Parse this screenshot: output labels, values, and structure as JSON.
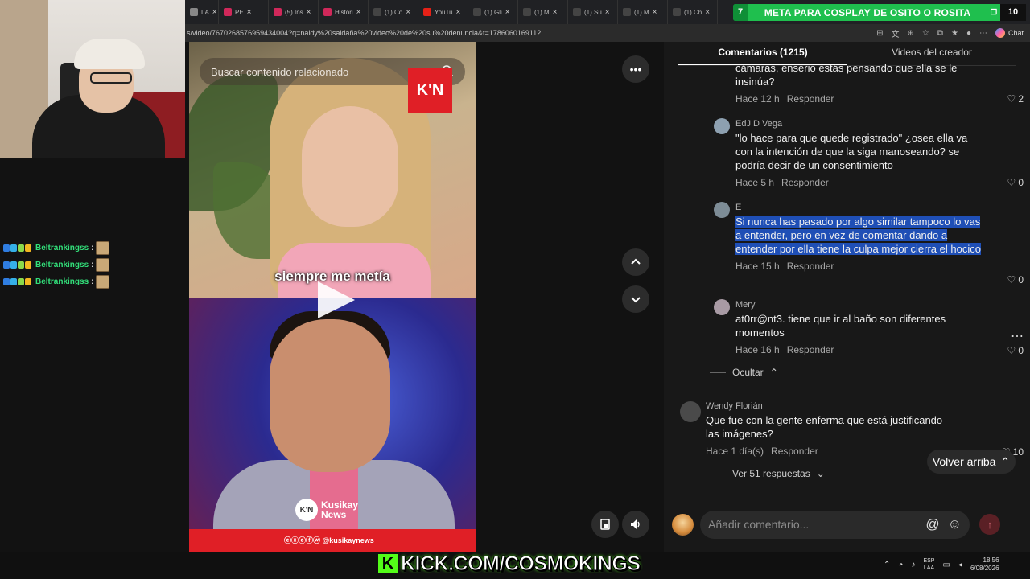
{
  "tabs": [
    {
      "label": "LA",
      "color": "#888888"
    },
    {
      "label": "PE",
      "color": "#d0285a"
    },
    {
      "label": "(5) Ins",
      "color": "#d0285a"
    },
    {
      "label": "Histori",
      "color": "#d0285a"
    },
    {
      "label": "(1) Co",
      "color": "#444444"
    },
    {
      "label": "YouTu",
      "color": "#e62117"
    },
    {
      "label": "(1) Gli",
      "color": "#444444"
    },
    {
      "label": "(1) M",
      "color": "#444444"
    },
    {
      "label": "(1) Su",
      "color": "#444444"
    },
    {
      "label": "(1) M",
      "color": "#444444"
    },
    {
      "label": "(1) Ch",
      "color": "#444444"
    }
  ],
  "goal_banner": {
    "level": "7",
    "text": "META PARA COSPLAY DE OSITO O ROSITA",
    "count": "10"
  },
  "url": "s/video/7670268576959434004?q=naldy%20saldaña%20video%20de%20su%20denuncia&t=1786060169112",
  "browser_chat_label": "Chat",
  "chat_overlay": [
    {
      "user": "Beltrankingss",
      "sep": ":"
    },
    {
      "user": "Beltrankingss",
      "sep": ":"
    },
    {
      "user": "Beltrankingss",
      "sep": ":"
    }
  ],
  "video": {
    "search_placeholder": "Buscar contenido relacionado",
    "logo": "K'N",
    "caption": "siempre me metía",
    "brand_logo": "K'N",
    "brand_name_1": "Kusikay",
    "brand_name_2": "News",
    "social_handle": "ⓒⓧⓞⓕⓦ @kusikaynews"
  },
  "panel": {
    "tab_comments": "Comentarios (1215)",
    "tab_creator_videos": "Videos del creador",
    "comments": [
      {
        "user": "",
        "text": "cámaras, enserio estás pensando que ella se le insinúa?",
        "time": "Hace 12 h",
        "reply": "Responder",
        "likes": "2"
      },
      {
        "user": "EdJ D Vega",
        "text": "\"lo hace para que quede registrado\" ¿osea ella va con la intención de que la siga manoseando? se podría decir de un consentimiento",
        "time": "Hace 5 h",
        "reply": "Responder",
        "likes": "0"
      },
      {
        "user": "E",
        "text": "Si nunca has pasado por algo similar tampoco lo vas a entender, pero en vez de comentar dando a entender por ella tiene la culpa mejor cierra el hocico",
        "time": "Hace 15 h",
        "reply": "Responder",
        "likes": "0"
      },
      {
        "user": "Mery",
        "text": "at0rr@nt3. tiene que ir al baño son diferentes momentos",
        "time": "Hace 16 h",
        "reply": "Responder",
        "likes": "0"
      },
      {
        "user": "Wendy Florián",
        "text": "Que fue con la gente enferma que está justificando las imágenes?",
        "time": "Hace 1 día(s)",
        "reply": "Responder",
        "likes": "10"
      }
    ],
    "hide_label": "Ocultar",
    "more_replies": "Ver 51 respuestas",
    "back_to_top": "Volver arriba",
    "add_comment_placeholder": "Añadir comentario..."
  },
  "kick_banner": "KICK.COM/COSMOKINGS",
  "taskbar": {
    "lang_1": "ESP",
    "lang_2": "LAA",
    "time": "18:56",
    "date": "6/08/2026"
  }
}
